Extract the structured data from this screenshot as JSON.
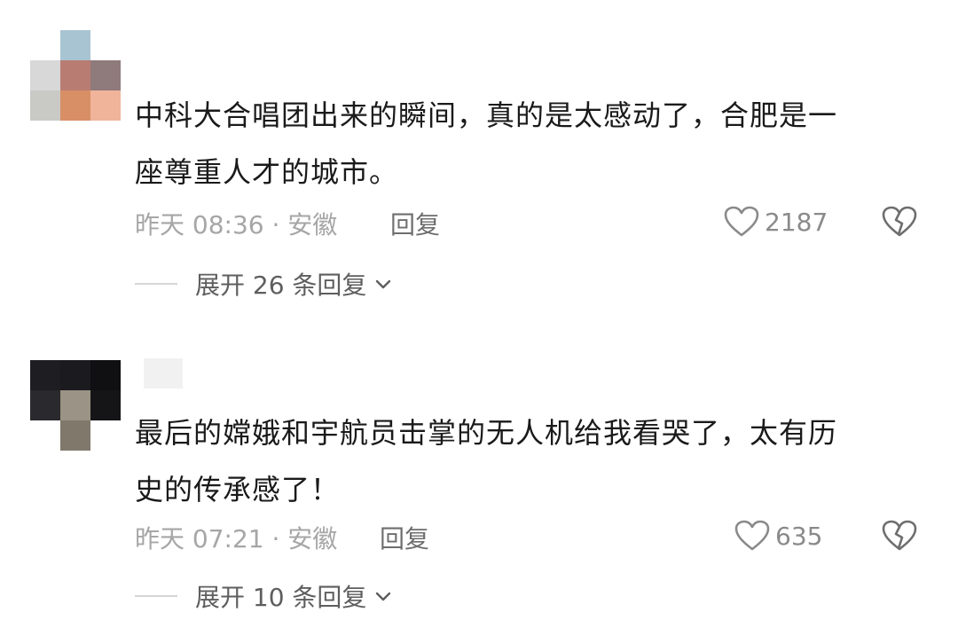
{
  "comments": [
    {
      "text_line1": "中科大合唱团出来的瞬间，真的是太感动了，合肥是一",
      "text_line2": "座尊重人才的城市。",
      "time_location": "昨天 08:36 · 安徽",
      "reply_label": "回复",
      "like_count": "2187",
      "expand_label": "展开 26 条回复",
      "avatar_colors": [
        "#ffffff",
        "#a8c4d2",
        "#ffffff",
        "#d8d8d8",
        "#b97c73",
        "#8f7a7c",
        "#c9c9c6",
        "#d88f66",
        "#f0b49a"
      ]
    },
    {
      "text_line1": "最后的嫦娥和宇航员击掌的无人机给我看哭了，太有历",
      "text_line2": "史的传承感了！",
      "time_location": "昨天 07:21 · 安徽",
      "reply_label": "回复",
      "like_count": "635",
      "expand_label": "展开 10 条回复",
      "avatar_colors": [
        "#1e1e22",
        "#1b1b1f",
        "#101012",
        "#2a2a2e",
        "#9b9486",
        "#151517",
        "#ffffff",
        "#7f786b",
        "#ffffff"
      ]
    }
  ],
  "icons": {
    "like": "heart-outline-icon",
    "dislike": "broken-heart-icon",
    "expand": "chevron-down-icon"
  },
  "colors": {
    "text": "#1a1a1a",
    "meta": "#a6a6a6",
    "reply": "#6e6e6e",
    "expand": "#5e5e5e"
  }
}
